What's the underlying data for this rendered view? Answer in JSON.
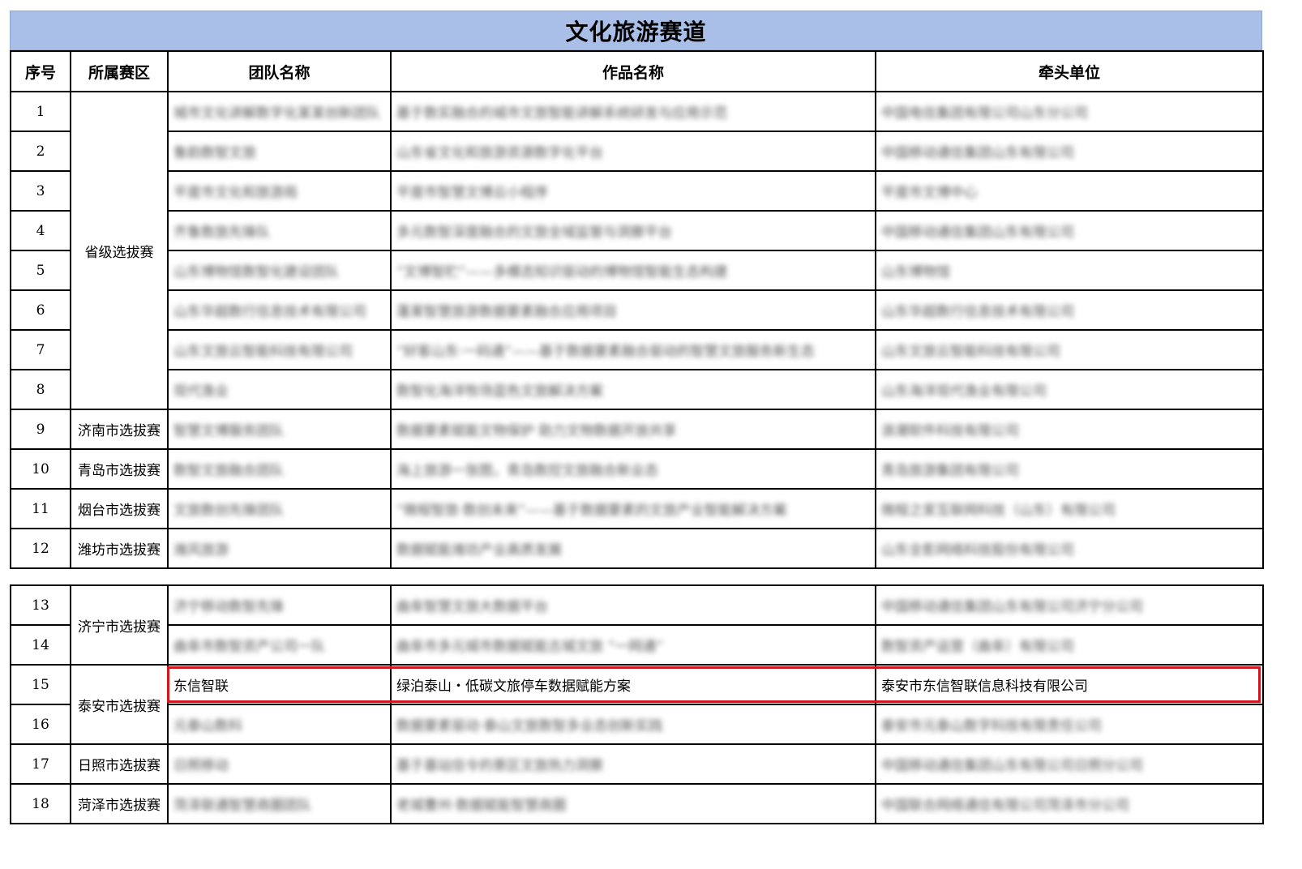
{
  "title": "文化旅游赛道",
  "headers": {
    "index": "序号",
    "region": "所属赛区",
    "team": "团队名称",
    "work": "作品名称",
    "unit": "牵头单位"
  },
  "regions": {
    "provincial": "省级选拔赛",
    "jinan": "济南市选拔赛",
    "qingdao": "青岛市选拔赛",
    "yantai": "烟台市选拔赛",
    "weifang": "潍坊市选拔赛",
    "jining": "济宁市选拔赛",
    "taian": "泰安市选拔赛",
    "rizhao": "日照市选拔赛",
    "heze": "菏泽市选拔赛"
  },
  "rows": [
    {
      "index": "1",
      "team": "城市文化讲解数字化某某创新团队",
      "work": "基于数实融合的城市文旅智能讲解系统研发与应用示范",
      "unit": "中国电信集团有限公司山东分公司"
    },
    {
      "index": "2",
      "team": "鲁韵数智文旅",
      "work": "山东省文化和旅游资源数字化平台",
      "unit": "中国移动通信集团山东有限公司"
    },
    {
      "index": "3",
      "team": "平度市文化和旅游局",
      "work": "平度市智慧文博云小程序",
      "unit": "平度市文博中心"
    },
    {
      "index": "4",
      "team": "齐鲁数旅先锋队",
      "work": "多元数智深度融合的文旅全域监管与洞察平台",
      "unit": "中国移动通信集团山东有限公司"
    },
    {
      "index": "5",
      "team": "山东博物馆数智化建设团队",
      "work": "“文博智贮”——多模态知识驱动的博物馆智能生态构建",
      "unit": "山东博物馆"
    },
    {
      "index": "6",
      "team": "山东华超数行信息技术有限公司",
      "work": "蓬莱智慧旅游数据要素融合应用项目",
      "unit": "山东华超数行信息技术有限公司"
    },
    {
      "index": "7",
      "team": "山东文旅云智能科技有限公司",
      "work": "“好客山东·一码通”——基于数据要素融合驱动的智慧文旅服务新生态",
      "unit": "山东文旅云智能科技有限公司"
    },
    {
      "index": "8",
      "team": "现代渔业",
      "work": "数智化海洋牧场蓝色文旅解决方案",
      "unit": "山东海洋现代渔业有限公司"
    },
    {
      "index": "9",
      "team": "智慧文博服务团队",
      "work": "数据要素赋能文物保护 助力文物数据开放共享",
      "unit": "浪潮软件科技有限公司"
    },
    {
      "index": "10",
      "team": "数智文旅融合团队",
      "work": "海上旅游一张图，青岛数控文旅融合新业态",
      "unit": "青岛旅游集团有限公司"
    },
    {
      "index": "11",
      "team": "文旅数创先锋团队",
      "work": "“微程智旅·数创未来”——基于数据要素的文旅产业智能解决方案",
      "unit": "微程之家互联网科技（山东）有限公司"
    },
    {
      "index": "12",
      "team": "潍风旅游",
      "work": "数据赋能潍坊产业高质发展",
      "unit": "山东全影网络科技股份有限公司"
    },
    {
      "index": "13",
      "team": "济宁移动数智先锋",
      "work": "曲阜智慧文旅大数据平台",
      "unit": "中国移动通信集团山东有限公司济宁分公司"
    },
    {
      "index": "14",
      "team": "曲阜市数智资产公司一队",
      "work": "曲阜市多元城市数据赋能古城文旅 “一网通”",
      "unit": "数智资产运营（曲阜）有限公司"
    },
    {
      "index": "15",
      "team": "东信智联",
      "work": "绿泊泰山・低碳文旅停车数据赋能方案",
      "unit": "泰安市东信智联信息科技有限公司"
    },
    {
      "index": "16",
      "team": "元泰山数科",
      "work": "数据要素驱动·泰山文旅数智多业态创新实践",
      "unit": "泰安市元泰山数字科技有限责任公司"
    },
    {
      "index": "17",
      "team": "日照移动",
      "work": "基于基站信令的景区文旅热力洞察",
      "unit": "中国移动通信集团山东有限公司日照分公司"
    },
    {
      "index": "18",
      "team": "菏泽联通智慧商圈团队",
      "work": "老城曹州·数据赋能智慧商圈",
      "unit": "中国联合网络通信有限公司菏泽市分公司"
    }
  ]
}
